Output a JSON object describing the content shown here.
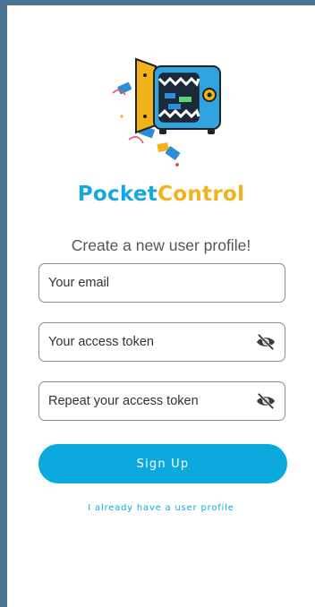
{
  "app": {
    "brand_part1": "Pocket",
    "brand_part2": "Control",
    "logo_icon": "safe-with-money-icon"
  },
  "form": {
    "heading": "Create a new user profile!",
    "email_placeholder": "Your email",
    "token_placeholder": "Your access token",
    "repeat_token_placeholder": "Repeat your access token",
    "visibility_icon": "eye-off-icon",
    "signup_label": "Sign Up",
    "login_link": "I already have a user profile"
  },
  "colors": {
    "primary": "#0ba9dd",
    "accent": "#f2b21a",
    "frame": "#4a7391"
  }
}
